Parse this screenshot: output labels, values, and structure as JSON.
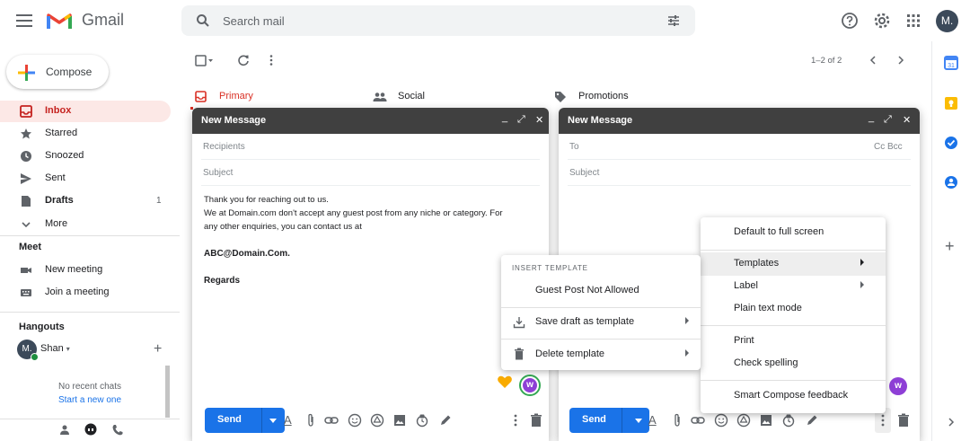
{
  "header": {
    "app_name": "Gmail",
    "search_placeholder": "Search mail",
    "avatar_initial": "M."
  },
  "sidebar": {
    "compose_label": "Compose",
    "items": [
      {
        "label": "Inbox",
        "count": ""
      },
      {
        "label": "Starred",
        "count": ""
      },
      {
        "label": "Snoozed",
        "count": ""
      },
      {
        "label": "Sent",
        "count": ""
      },
      {
        "label": "Drafts",
        "count": "1"
      },
      {
        "label": "More",
        "count": ""
      }
    ],
    "meet": {
      "title": "Meet",
      "new_meeting": "New meeting",
      "join_meeting": "Join a meeting"
    },
    "hangouts": {
      "title": "Hangouts",
      "avatar_initial": "M.",
      "user": "Shan",
      "no_chats": "No recent chats",
      "start_new": "Start a new one"
    }
  },
  "list": {
    "pagination": "1–2 of 2",
    "tabs": [
      {
        "label": "Primary"
      },
      {
        "label": "Social"
      },
      {
        "label": "Promotions"
      }
    ]
  },
  "compose_left": {
    "title": "New Message",
    "recipients_placeholder": "Recipients",
    "subject_placeholder": "Subject",
    "body_line1": "Thank you for reaching out to us.",
    "body_line2": "We at Domain.com don't accept any guest post from any niche or category. For",
    "body_line3": "any other enquiries, you can contact us at",
    "body_email": "ABC@Domain.Com.",
    "body_regards": "Regards",
    "send_label": "Send"
  },
  "compose_right": {
    "title": "New Message",
    "to_placeholder": "To",
    "cc_bcc": "Cc Bcc",
    "subject_placeholder": "Subject",
    "send_label": "Send"
  },
  "template_menu": {
    "caption": "INSERT TEMPLATE",
    "template_item": "Guest Post Not Allowed",
    "save_draft": "Save draft as template",
    "delete_template": "Delete template"
  },
  "options_menu": {
    "items": [
      "Default to full screen",
      "Templates",
      "Label",
      "Plain text mode",
      "Print",
      "Check spelling",
      "Smart Compose feedback"
    ]
  },
  "colors": {
    "accent_blue": "#1a73e8",
    "inbox_red": "#c5221f",
    "inbox_bg": "#fce8e6",
    "compose_header": "#404040"
  }
}
